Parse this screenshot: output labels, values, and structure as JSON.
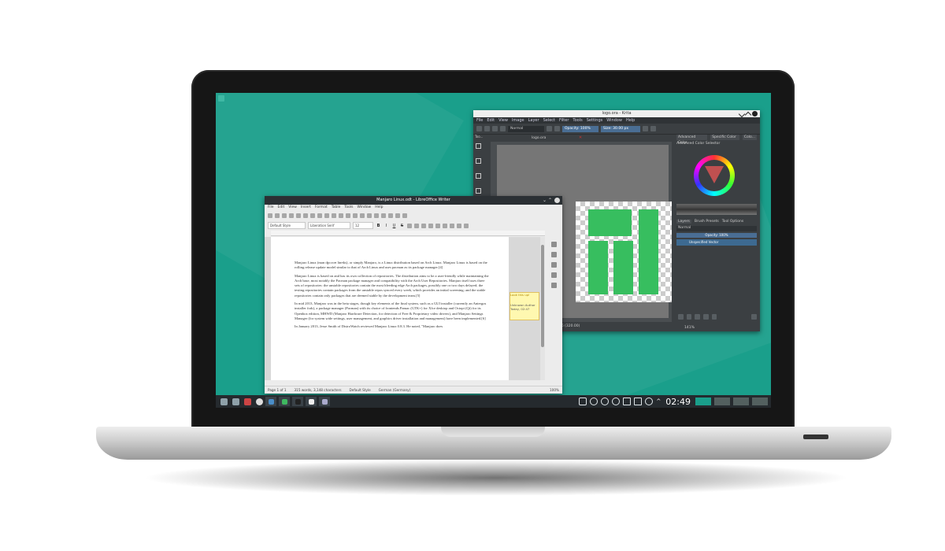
{
  "taskbar": {
    "clock": "02:49"
  },
  "krita": {
    "title": "logo.ora - Krita",
    "menu": [
      "File",
      "Edit",
      "View",
      "Image",
      "Layer",
      "Select",
      "Filter",
      "Tools",
      "Settings",
      "Window",
      "Help"
    ],
    "blend_mode": "Normal",
    "opacity": "Opacity: 100%",
    "size": "Size: 30.00 px",
    "doc_tab": "logo.ora",
    "tools_title": "Too...",
    "dock_tabs": [
      "Advanced Color...",
      "Specific Color ...",
      "Colo..."
    ],
    "color_selector_title": "Advanced Color Selector",
    "layers_tabs": [
      "Layers",
      "Brush Presets",
      "Tool Options"
    ],
    "layers_blend": "Normal",
    "layers_opacity": "Opacity: 100%",
    "layer_name": "Unspecified Vector",
    "status_size": "231 x 246 (320.00)",
    "status_zoom": "141%"
  },
  "writer": {
    "title": "Manjaro Linux.odt - LibreOffice Writer",
    "menu": [
      "File",
      "Edit",
      "View",
      "Insert",
      "Format",
      "Table",
      "Tools",
      "Window",
      "Help"
    ],
    "para_style": "Default Style",
    "font_name": "Liberation Serif",
    "font_size": "12",
    "paragraphs": [
      "Manjaro Linux (man ʤɑːroʊ linʊks), or simply Manjaro, is a Linux distribution based on Arch Linux. Manjaro Linux is based on the rolling release update model similar to that of Arch Linux and uses pacman as its package manager.[4]",
      "Manjaro Linux is based on and has its own collection of repositories. The distribution aims to be a user-friendly while maintaining the Arch base, most notably the Pacman package manager and compatibility with the Arch User Repositories. Manjaro itself uses three sets of repositories: the unstable repositories contain the most bleeding edge Arch packages, possibly one or two days delayed; the testing repositories contain packages from the unstable repos synced every week, which provides an initial screening; and the stable repositories contain only packages that are deemed stable by the development team.[5]",
      "In mid 2013, Manjaro was in the beta stages, though key elements of the final system, such as a GUI installer (currently an Antergos installer fork), a package manager (Pacman) with its choice of frontends Pamac (GTK+) for Xfce desktop and Octopi (Qt) for its Openbox edition, MHWD (Manjaro Hardware Detection, for detection of Free & Proprietary video drivers), and Manjaro Settings Manager (for system wide settings, user management, and graphics driver installation and management) have been implemented.[6]",
      "In January 2013, Jesse Smith of DistroWatch reviewed Manjaro Linux 0.8.3. He noted, \"Manjaro does"
    ],
    "comment_head": "Look this up!",
    "comment_author": "Unknown Author",
    "comment_date": "Today, 02:47",
    "status_page": "Page 1 of 1",
    "status_words": "315 words, 3,148 characters",
    "status_style": "Default Style",
    "status_lang": "German (Germany)",
    "status_zoom": "100%"
  }
}
